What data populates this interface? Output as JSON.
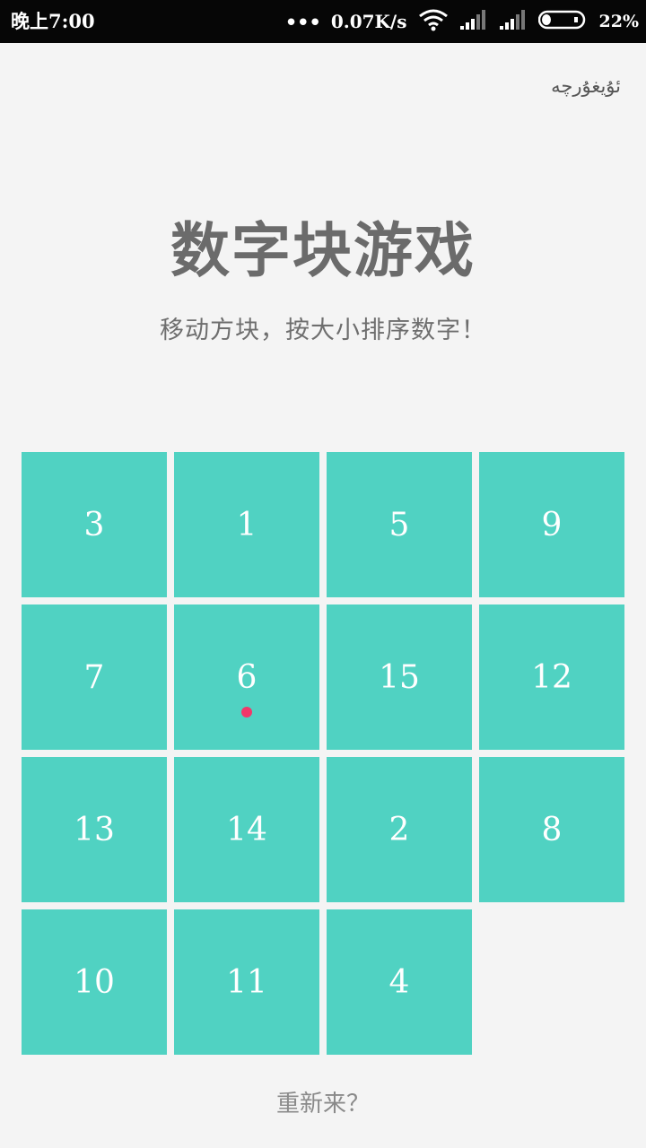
{
  "status_bar": {
    "time": "晚上7:00",
    "dots": "•••",
    "network_speed": "0.07K/s",
    "battery_percent": "22%",
    "battery_level": 0.22,
    "icons": [
      "wifi-icon",
      "signal-icon",
      "signal-icon",
      "battery-icon"
    ]
  },
  "header": {
    "language_link": "ئۇيغۇرچە",
    "title": "数字块游戏",
    "subtitle": "移动方块，按大小排序数字！"
  },
  "board": {
    "rows": 4,
    "cols": 4,
    "grid": [
      [
        3,
        1,
        5,
        9
      ],
      [
        7,
        6,
        15,
        12
      ],
      [
        13,
        14,
        2,
        8
      ],
      [
        10,
        11,
        4,
        null
      ]
    ],
    "marked_tile": 6
  },
  "colors": {
    "tile": "#50d2c2",
    "tile_text": "#ffffff",
    "marker": "#f2386a",
    "background": "#f4f4f4"
  },
  "footer": {
    "restart_label": "重新来？"
  }
}
